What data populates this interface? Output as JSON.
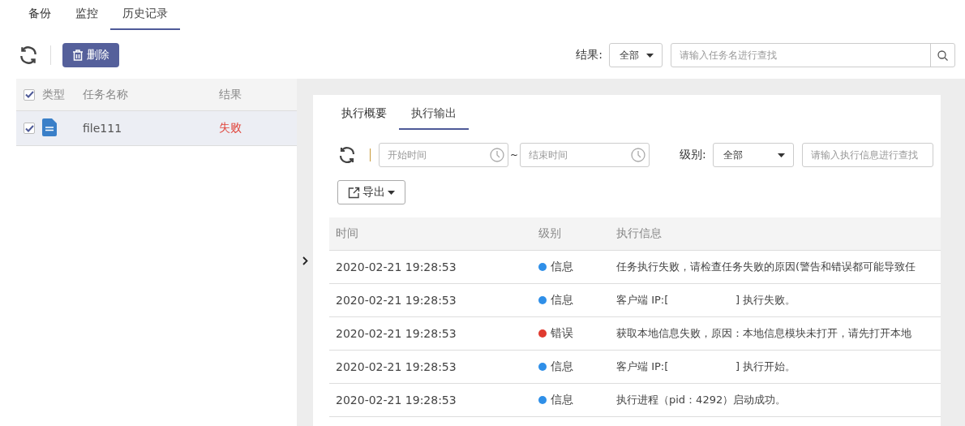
{
  "tabs": [
    {
      "label": "备份",
      "selected": false
    },
    {
      "label": "监控",
      "selected": false
    },
    {
      "label": "历史记录",
      "selected": true
    }
  ],
  "toolbar": {
    "delete_button": "删除",
    "result_filter": {
      "label": "结果:",
      "value": "全部"
    },
    "search": {
      "placeholder": "请输入任务名进行查找"
    }
  },
  "task_table": {
    "select_all_checked": true,
    "columns": [
      "类型",
      "任务名称",
      "结果"
    ],
    "rows": [
      {
        "name": "file111",
        "result": "失败",
        "checked": true,
        "selected": true
      }
    ]
  },
  "detail": {
    "tabs": [
      {
        "label": "执行概要",
        "selected": false
      },
      {
        "label": "执行输出",
        "selected": true
      }
    ],
    "start_time": {
      "placeholder": "开始时间"
    },
    "separator": "~",
    "end_time": {
      "placeholder": "结束时间"
    },
    "level_filter": {
      "label": "级别:",
      "value": "全部"
    },
    "search": {
      "placeholder": "请输入执行信息进行查找"
    },
    "export_button": "导出",
    "log_table": {
      "columns": [
        "时间",
        "级别",
        "执行信息"
      ],
      "rows": [
        {
          "time": "2020-02-21 19:28:53",
          "level": "信息",
          "color": "#2f8fe8",
          "message": "任务执行失败，请检查任务失败的原因(警告和错误都可能导致任"
        },
        {
          "time": "2020-02-21 19:28:53",
          "level": "信息",
          "color": "#2f8fe8",
          "message": "客户端 IP:[                    ] 执行失败。"
        },
        {
          "time": "2020-02-21 19:28:53",
          "level": "错误",
          "color": "#e03a2f",
          "message": "获取本地信息失败，原因：本地信息模块未打开，请先打开本地"
        },
        {
          "time": "2020-02-21 19:28:53",
          "level": "信息",
          "color": "#2f8fe8",
          "message": "客户端 IP:[                    ] 执行开始。"
        },
        {
          "time": "2020-02-21 19:28:53",
          "level": "信息",
          "color": "#2f8fe8",
          "message": "执行进程（pid：4292）启动成功。"
        }
      ]
    }
  }
}
